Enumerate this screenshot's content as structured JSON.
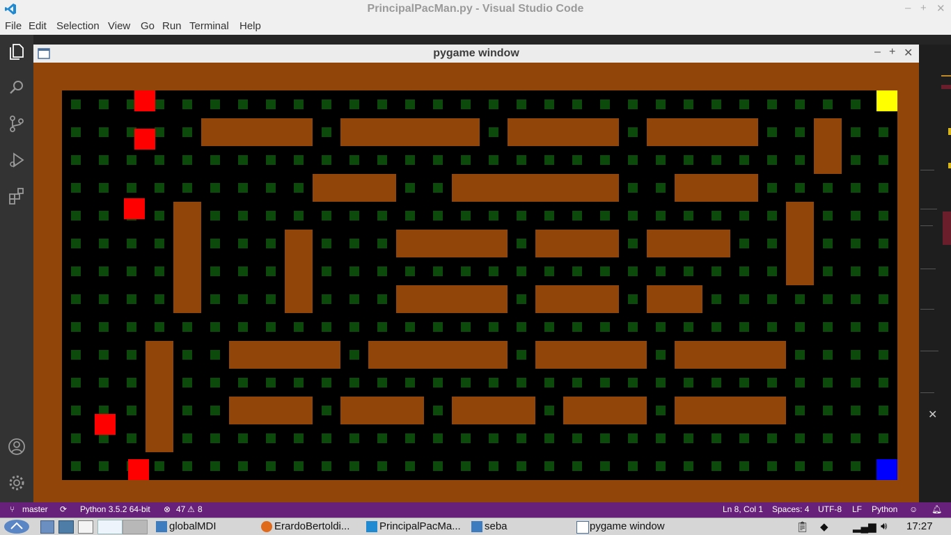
{
  "vscode": {
    "title": "PrincipalPacMan.py - Visual Studio Code",
    "menu": [
      "File",
      "Edit",
      "Selection",
      "View",
      "Go",
      "Run",
      "Terminal",
      "Help"
    ]
  },
  "pygame": {
    "title": "pygame window",
    "colors": {
      "wall": "#914508",
      "floor": "#000000",
      "pellet": "#0b4a0b",
      "ghost": "#ff0000",
      "pacman": "#ffff00",
      "target": "#0000ff"
    }
  },
  "status": {
    "branch": "master",
    "python": "Python 3.5.2 64-bit",
    "problems": "47",
    "warnings": "8",
    "cursor": "Ln 8, Col 1",
    "spaces": "Spaces: 4",
    "encoding": "UTF-8",
    "eol": "LF",
    "language": "Python"
  },
  "taskbar": {
    "items": [
      "globalMDI",
      "ErardoBertoldi...",
      "PrincipalPacMa...",
      "seba",
      "pygame window"
    ],
    "clock": "17:27"
  }
}
